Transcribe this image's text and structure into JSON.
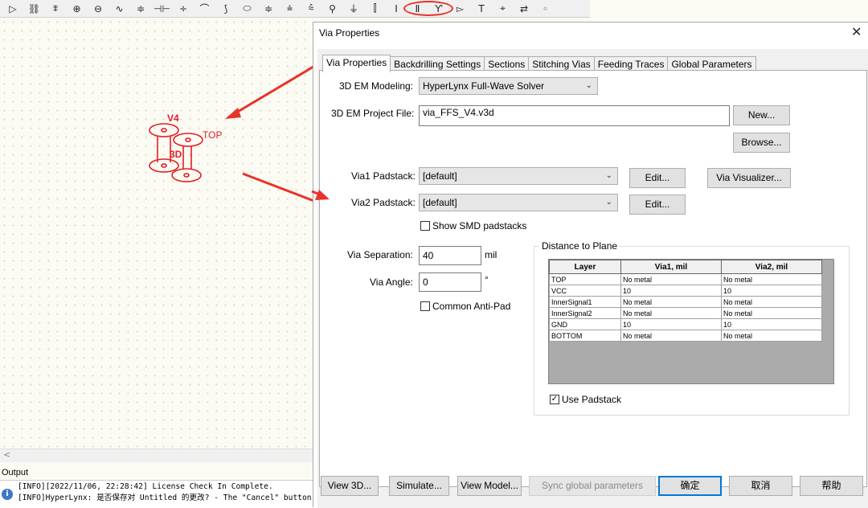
{
  "toolbar": {
    "icons": [
      "▷",
      "⛓",
      "⩨",
      "⊕",
      "⊖",
      "∿",
      "≑",
      "⊣⊢",
      "÷",
      "⌒",
      "⟆",
      "⬭",
      "≑",
      "⩮",
      "⩯",
      "⚲",
      "⏚",
      "⫿",
      "Ⅰ",
      "Ⅱ",
      "Ƴ",
      "▻",
      "T",
      "⌖",
      "⇄",
      "⚬"
    ],
    "icon_names": [
      "driver-icon",
      "receiver-icon",
      "ic-component-icon",
      "terminator-icon",
      "probe-icon",
      "resistor-icon",
      "capacitor-icon",
      "inductor-icon",
      "diode-icon",
      "jumper-icon",
      "connector-icon",
      "transmission-line-icon",
      "coupled-line-icon",
      "differential-line-icon",
      "stub-icon",
      "test-point-icon",
      "ground-icon",
      "via-icon",
      "via-single-icon",
      "via-3d-icon",
      "branch-icon",
      "port-icon",
      "text-icon",
      "crosshair-icon",
      "swap-icon",
      "disabled-icon"
    ]
  },
  "canvas": {
    "via_label": "V4",
    "top_label": "TOP",
    "em_label": "3D"
  },
  "output": {
    "title": "Output",
    "lines": [
      "[INFO][2022/11/06, 22:28:42] License Check In Complete.",
      "[INFO]HyperLynx: 是否保存对 Untitled 的更改? - The \"Cancel\" button"
    ]
  },
  "dialog": {
    "title": "Via Properties",
    "close": "✕",
    "tabs": [
      "Via Properties",
      "Backdrilling Settings",
      "Sections",
      "Stitching Vias",
      "Feeding Traces",
      "Global Parameters"
    ],
    "em_modeling_label": "3D EM Modeling:",
    "em_modeling_value": "HyperLynx Full-Wave Solver",
    "project_file_label": "3D EM Project File:",
    "project_file_value": "via_FFS_V4.v3d",
    "new_button": "New...",
    "browse_button": "Browse...",
    "via1_label": "Via1 Padstack:",
    "via1_value": "[default]",
    "via2_label": "Via2 Padstack:",
    "via2_value": "[default]",
    "edit_button": "Edit...",
    "visualizer_button": "Via Visualizer...",
    "show_smd_label": "Show SMD padstacks",
    "separation_label": "Via Separation:",
    "separation_value": "40",
    "separation_unit": "mil",
    "angle_label": "Via Angle:",
    "angle_value": "0",
    "angle_unit": "°",
    "common_antipad_label": "Common Anti-Pad",
    "distance_group": "Distance to Plane",
    "table": {
      "headers": [
        "Layer",
        "Via1, mil",
        "Via2, mil"
      ],
      "rows": [
        [
          "TOP",
          "No metal",
          "No metal"
        ],
        [
          "VCC",
          "10",
          "10"
        ],
        [
          "InnerSignal1",
          "No metal",
          "No metal"
        ],
        [
          "InnerSignal2",
          "No metal",
          "No metal"
        ],
        [
          "GND",
          "10",
          "10"
        ],
        [
          "BOTTOM",
          "No metal",
          "No metal"
        ]
      ]
    },
    "use_padstack_label": "Use Padstack",
    "use_padstack_check": "✓",
    "buttons": {
      "view3d": "View 3D...",
      "simulate": "Simulate...",
      "view_model": "View Model...",
      "sync": "Sync global parameters",
      "ok": "确定",
      "cancel": "取消",
      "help": "帮助"
    }
  },
  "colors": {
    "annotation_red": "#e8332b",
    "via_red": "#e31e24"
  }
}
